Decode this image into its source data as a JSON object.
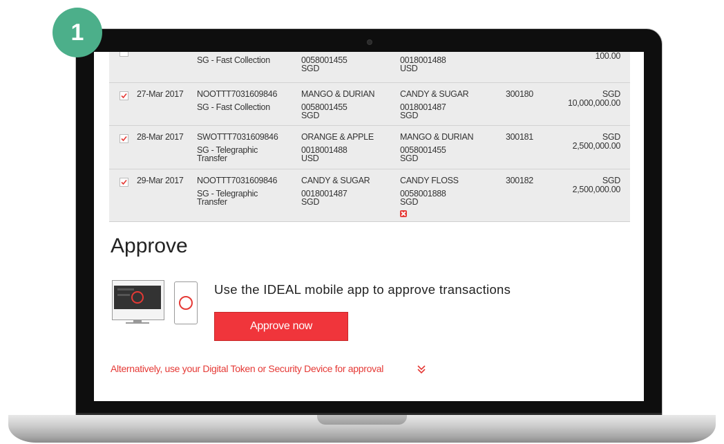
{
  "step": {
    "number": "1"
  },
  "transactions": [
    {
      "checked": false,
      "date": "",
      "ref": "",
      "type": "SG - Fast Collection",
      "type2": "",
      "from_name": "",
      "from_acct": "0058001455",
      "from_ccy": "SGD",
      "to_name": "",
      "to_acct": "0018001488",
      "to_ccy": "USD",
      "batch": "",
      "ccy": "",
      "amount": "100.00",
      "error": false
    },
    {
      "checked": true,
      "date": "27-Mar 2017",
      "ref": "NOOTTT7031609846",
      "type": "SG - Fast Collection",
      "type2": "",
      "from_name": "MANGO & DURIAN",
      "from_acct": "0058001455",
      "from_ccy": "SGD",
      "to_name": "CANDY & SUGAR",
      "to_acct": "0018001487",
      "to_ccy": "SGD",
      "batch": "300180",
      "ccy": "SGD",
      "amount": "10,000,000.00",
      "error": false
    },
    {
      "checked": true,
      "date": "28-Mar 2017",
      "ref": "SWOTTT7031609846",
      "type": "SG - Telegraphic",
      "type2": "Transfer",
      "from_name": "ORANGE & APPLE",
      "from_acct": "0018001488",
      "from_ccy": "USD",
      "to_name": "MANGO & DURIAN",
      "to_acct": "0058001455",
      "to_ccy": "SGD",
      "batch": "300181",
      "ccy": "SGD",
      "amount": "2,500,000.00",
      "error": false
    },
    {
      "checked": true,
      "date": "29-Mar 2017",
      "ref": "NOOTTT7031609846",
      "type": "SG - Telegraphic",
      "type2": "Transfer",
      "from_name": "CANDY & SUGAR",
      "from_acct": "0018001487",
      "from_ccy": "SGD",
      "to_name": "CANDY FLOSS",
      "to_acct": "0058001888",
      "to_ccy": "SGD",
      "batch": "300182",
      "ccy": "SGD",
      "amount": "2,500,000.00",
      "error": true
    }
  ],
  "approve": {
    "title": "Approve",
    "description": "Use the IDEAL mobile app to approve transactions",
    "button_label": "Approve now",
    "alternative_link": "Alternatively, use your Digital Token or Security Device for approval"
  },
  "colors": {
    "accent": "#f0353b",
    "step_badge": "#4caf8a",
    "table_bg": "#ececec"
  },
  "icons": {
    "monitor": "monitor-approve-icon",
    "phone": "phone-approve-icon",
    "chevron": "double-chevron-down-icon",
    "error": "error-icon",
    "check": "checkmark-icon"
  }
}
